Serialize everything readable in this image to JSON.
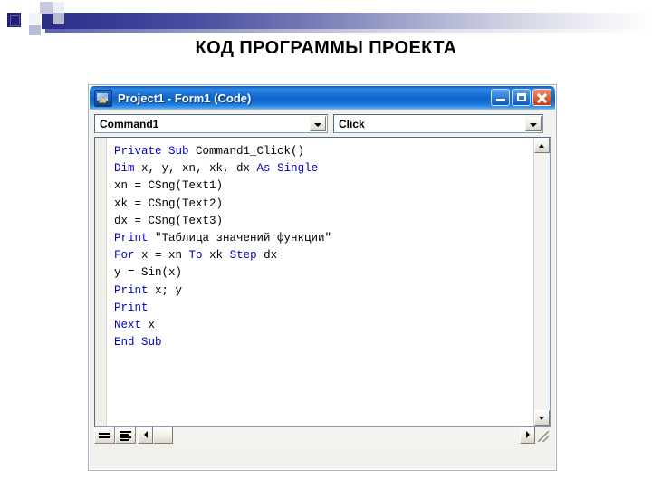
{
  "slide": {
    "title": "КОД ПРОГРАММЫ ПРОЕКТА",
    "accent_color": "#2b2f86"
  },
  "window": {
    "title": "Project1 - Form1 (Code)",
    "icon": "vb-form-icon",
    "buttons": {
      "minimize": "Minimize",
      "maximize": "Maximize",
      "close": "Close"
    }
  },
  "toolbar": {
    "object_combo": {
      "value": "Command1",
      "arrow": "chevron-down-icon"
    },
    "procedure_combo": {
      "value": "Click",
      "arrow": "chevron-down-icon"
    }
  },
  "code": {
    "language": "Visual Basic",
    "lines": [
      [
        {
          "t": "Private Sub ",
          "c": "kw"
        },
        {
          "t": "Command1_Click()",
          "c": ""
        }
      ],
      [
        {
          "t": "Dim ",
          "c": "kw"
        },
        {
          "t": "x, y, xn, xk, dx ",
          "c": ""
        },
        {
          "t": "As ",
          "c": "kw"
        },
        {
          "t": "Single",
          "c": "kw"
        }
      ],
      [
        {
          "t": "xn = CSng(Text1)",
          "c": ""
        }
      ],
      [
        {
          "t": "xk = CSng(Text2)",
          "c": ""
        }
      ],
      [
        {
          "t": "dx = CSng(Text3)",
          "c": ""
        }
      ],
      [
        {
          "t": "Print ",
          "c": "kw"
        },
        {
          "t": "\"Таблица значений функции\"",
          "c": "str"
        }
      ],
      [
        {
          "t": "For ",
          "c": "kw"
        },
        {
          "t": "x = xn ",
          "c": ""
        },
        {
          "t": "To ",
          "c": "kw"
        },
        {
          "t": "xk ",
          "c": ""
        },
        {
          "t": "Step ",
          "c": "kw"
        },
        {
          "t": "dx",
          "c": ""
        }
      ],
      [
        {
          "t": "y = Sin(x)",
          "c": ""
        }
      ],
      [
        {
          "t": "Print ",
          "c": "kw"
        },
        {
          "t": "x; y",
          "c": ""
        }
      ],
      [
        {
          "t": "Print",
          "c": "kw"
        }
      ],
      [
        {
          "t": "Next ",
          "c": "kw"
        },
        {
          "t": "x",
          "c": ""
        }
      ],
      [
        {
          "t": "End Sub",
          "c": "kw"
        }
      ]
    ],
    "keyword_color": "#0000C0",
    "text_color": "#000000"
  },
  "scrollbars": {
    "vertical": {
      "up": "scroll-up-icon",
      "down": "scroll-down-icon"
    },
    "horizontal": {
      "left": "scroll-left-icon",
      "right": "scroll-right-icon"
    }
  },
  "status": {
    "procedure_view": "Procedure View",
    "full_module_view": "Full Module View",
    "resize_grip": "resize-grip-icon"
  }
}
